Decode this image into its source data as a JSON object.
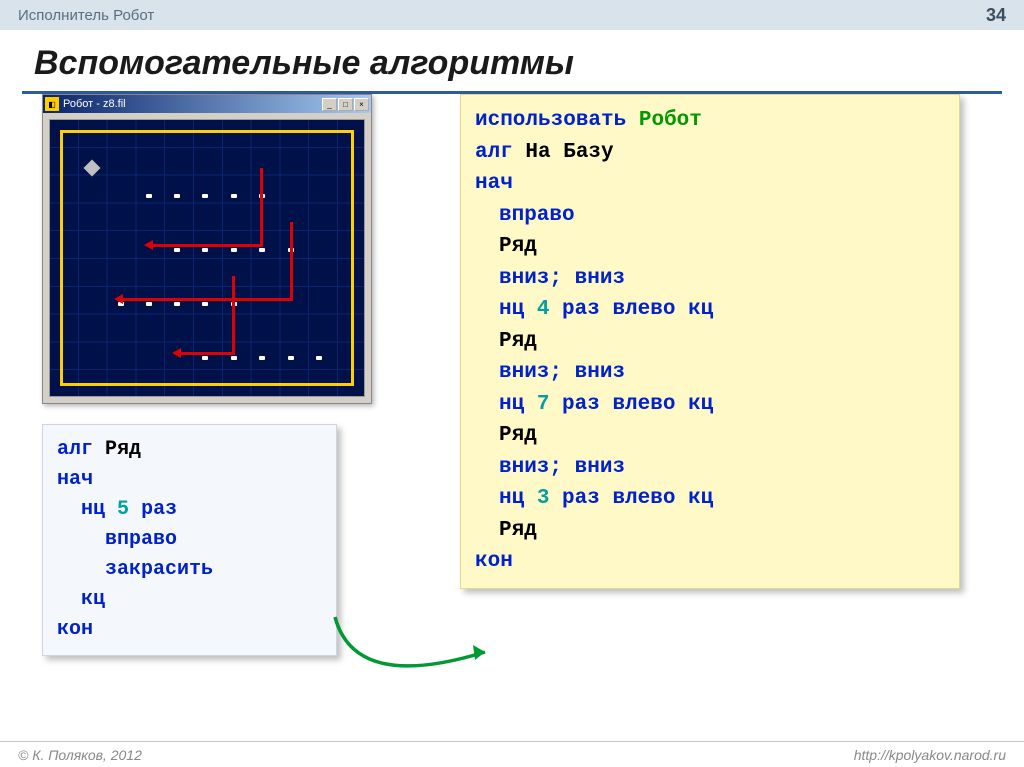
{
  "header": {
    "title": "Исполнитель Робот",
    "page": "34"
  },
  "main_title": "Вспомогательные алгоритмы",
  "robot_window": {
    "title": "Робот - z8.fil"
  },
  "sub_alg": {
    "l1_kw1": "алг",
    "l1_name": "Ряд",
    "l2": "нач",
    "l3_kw": "нц",
    "l3_num": "5",
    "l3_rest": "раз",
    "l4": "вправо",
    "l5": "закрасить",
    "l6": "кц",
    "l7": "кон"
  },
  "main_alg": {
    "l1_kw": "использовать",
    "l1_name": "Робот",
    "l2_kw": "алг",
    "l2_name": "На Базу",
    "l3": "нач",
    "l4": "вправо",
    "l5": "Ряд",
    "l6a": "вниз",
    "l6b": "вниз",
    "l7_kw1": "нц",
    "l7_num": "4",
    "l7_rest": "раз влево кц",
    "l8": "Ряд",
    "l9a": "вниз",
    "l9b": "вниз",
    "l10_kw1": "нц",
    "l10_num": "7",
    "l10_rest": "раз влево кц",
    "l11": "Ряд",
    "l12a": "вниз",
    "l12b": "вниз",
    "l13_kw1": "нц",
    "l13_num": "3",
    "l13_rest": "раз влево кц",
    "l14": "Ряд",
    "l15": "кон"
  },
  "footer": {
    "copyright": "© К. Поляков, 2012",
    "url": "http://kpolyakov.narod.ru"
  }
}
